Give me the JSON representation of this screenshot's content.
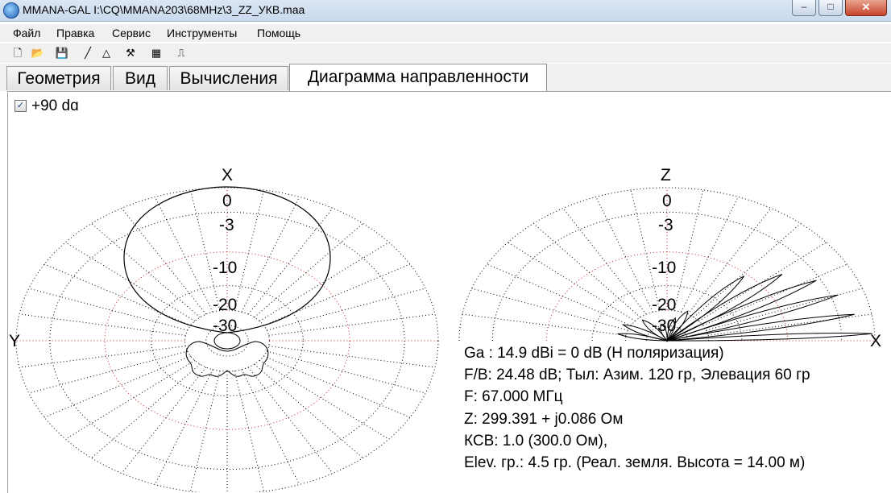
{
  "window": {
    "title": "MMANA-GAL I:\\CQ\\MMANA203\\68MHz\\3_ZZ_УКВ.maa",
    "minimize": "–",
    "maximize": "□",
    "close": "✕"
  },
  "menu": [
    "Файл",
    "Правка",
    "Сервис",
    "Инструменты",
    "Помощь"
  ],
  "toolbar": {
    "new": "🗋",
    "open": "📂",
    "save": "💾",
    "line": "╱",
    "triangle": "△",
    "tools": "⚒",
    "calculator": "▦",
    "report": "⎍"
  },
  "tabs": [
    "Геометрия",
    "Вид",
    "Вычисления",
    "Диаграмма направленности"
  ],
  "active_tab": "Диаграмма направленности",
  "pattern": {
    "checkbox_checked": true,
    "checkbox_label": "+90 dɑ",
    "left_plot": {
      "top_axis": "X",
      "left_axis": "Y",
      "rings": [
        "0",
        "-3",
        "-10",
        "-20",
        "-30"
      ]
    },
    "right_plot": {
      "top_axis": "Z",
      "right_axis": "X",
      "rings": [
        "0",
        "-3",
        "-10",
        "-20",
        "-30"
      ]
    },
    "info": {
      "gain": "Ga : 14.9 dBi = 0 dB  (H поляризация)",
      "fb": "F/B: 24.48 dB; Тыл: Азим. 120 гр, Элевация 60 гр",
      "freq": "F: 67.000 МГц",
      "impedance": "Z: 299.391 + j0.086 Ом",
      "swr": "КСВ: 1.0 (300.0 Ом),",
      "elev": "Elev. гр.: 4.5 гр. (Реал. земля. Высота = 14.00 м)"
    },
    "colors": {
      "grid_dots": "#000000",
      "red_ring": "#cc2222",
      "pattern_line": "#000000"
    }
  }
}
